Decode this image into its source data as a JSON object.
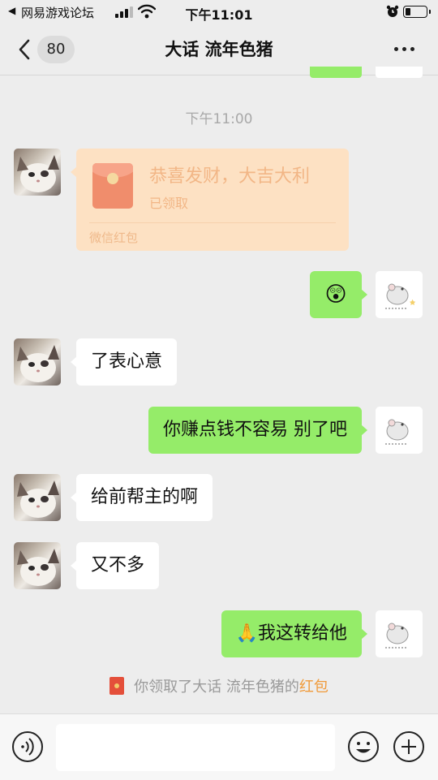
{
  "status_bar": {
    "back_glyph": "◀",
    "carrier": "网易游戏论坛",
    "time": "下午11:01",
    "battery_level": 0.25
  },
  "nav": {
    "unread_count": "80",
    "title": "大话 流年色猪",
    "more_icon": "more-icon"
  },
  "timestamp": "下午11:00",
  "red_packet": {
    "title": "恭喜发财，大吉大利",
    "status": "已领取",
    "footer": "微信红包"
  },
  "messages": [
    {
      "side": "right",
      "type": "emoji",
      "text": "😲"
    },
    {
      "side": "left",
      "text": "了表心意"
    },
    {
      "side": "right",
      "text": "你赚点钱不容易 别了吧"
    },
    {
      "side": "left",
      "text": "给前帮主的啊"
    },
    {
      "side": "left",
      "text": "又不多"
    },
    {
      "side": "right",
      "text": "🙏我这转给他"
    }
  ],
  "system_note": {
    "prefix": "你领取了大话 流年色猪的",
    "link": "红包"
  },
  "input_bar": {
    "placeholder": ""
  },
  "colors": {
    "background": "#ededed",
    "my_bubble": "#95ec69",
    "their_bubble": "#ffffff",
    "packet_bg": "#fde1c3",
    "link": "#f09a3a"
  }
}
